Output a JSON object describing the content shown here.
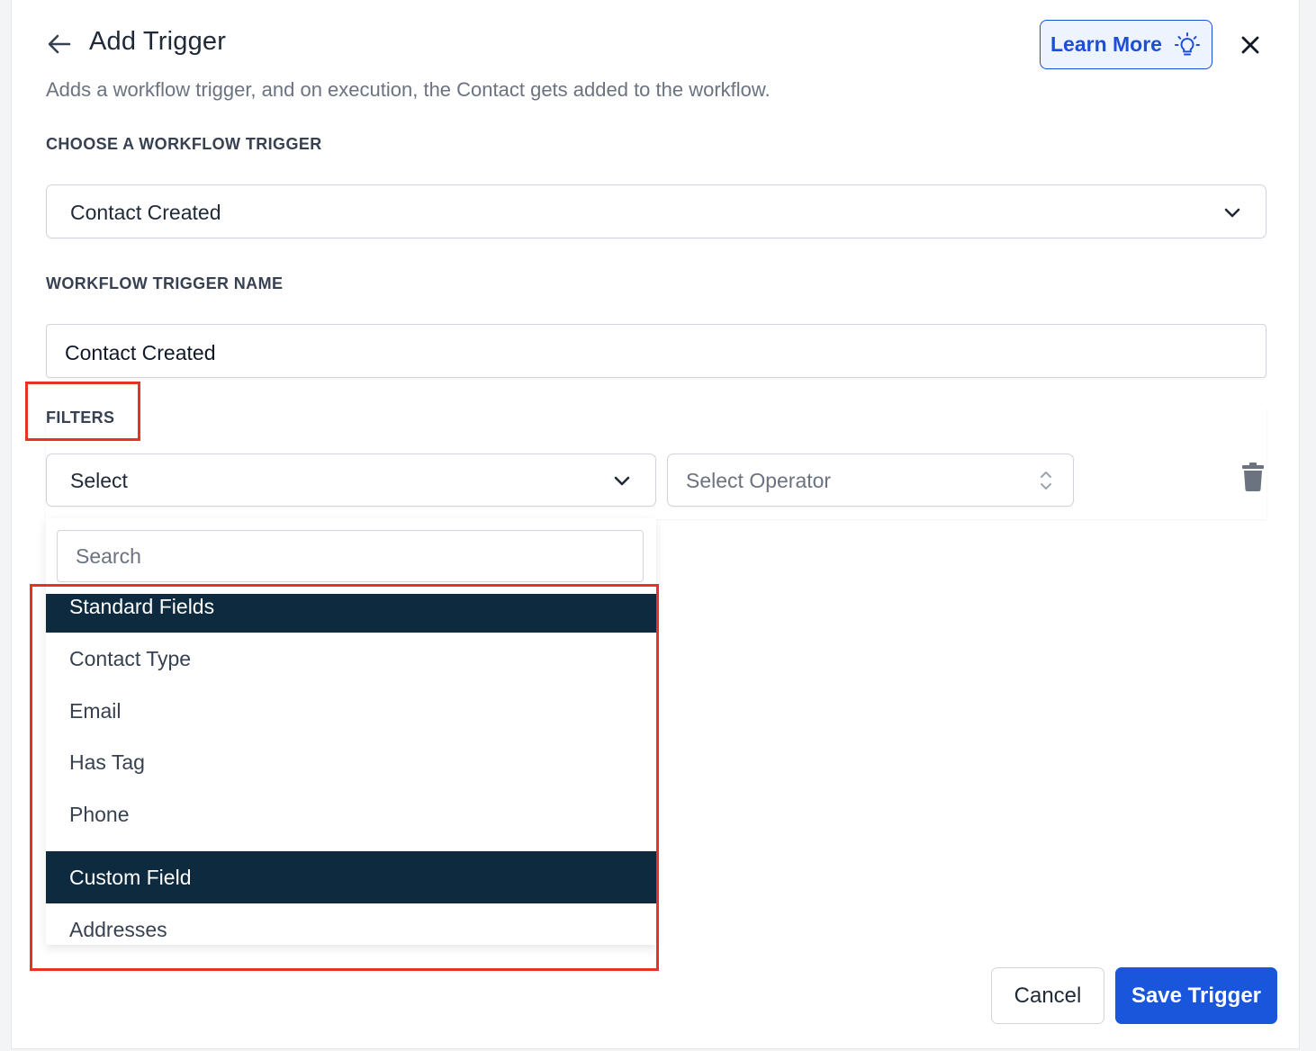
{
  "header": {
    "title": "Add Trigger",
    "subtitle": "Adds a workflow trigger, and on execution, the Contact gets added to the workflow.",
    "learn_more_label": "Learn More",
    "icons": {
      "back": "arrow-left-icon",
      "learn_more": "lightbulb-icon",
      "close": "close-icon"
    }
  },
  "trigger_section": {
    "label": "CHOOSE A WORKFLOW TRIGGER",
    "selected_value": "Contact Created"
  },
  "trigger_name_section": {
    "label": "WORKFLOW TRIGGER NAME",
    "value": "Contact Created"
  },
  "filters": {
    "label": "FILTERS",
    "field_select_value": "Select",
    "operator_placeholder": "Select Operator",
    "delete_icon": "trash-icon"
  },
  "dropdown": {
    "search_placeholder": "Search",
    "groups": [
      {
        "header": "Standard Fields",
        "options": [
          "Contact Type",
          "Email",
          "Has Tag",
          "Phone"
        ]
      },
      {
        "header": "Custom Field",
        "options": [
          "Addresses"
        ]
      }
    ]
  },
  "footer": {
    "cancel_label": "Cancel",
    "save_label": "Save Trigger"
  },
  "colors": {
    "accent": "#1a56db",
    "group_header_bg": "#0e2a3f",
    "highlight_box": "#e63323"
  }
}
